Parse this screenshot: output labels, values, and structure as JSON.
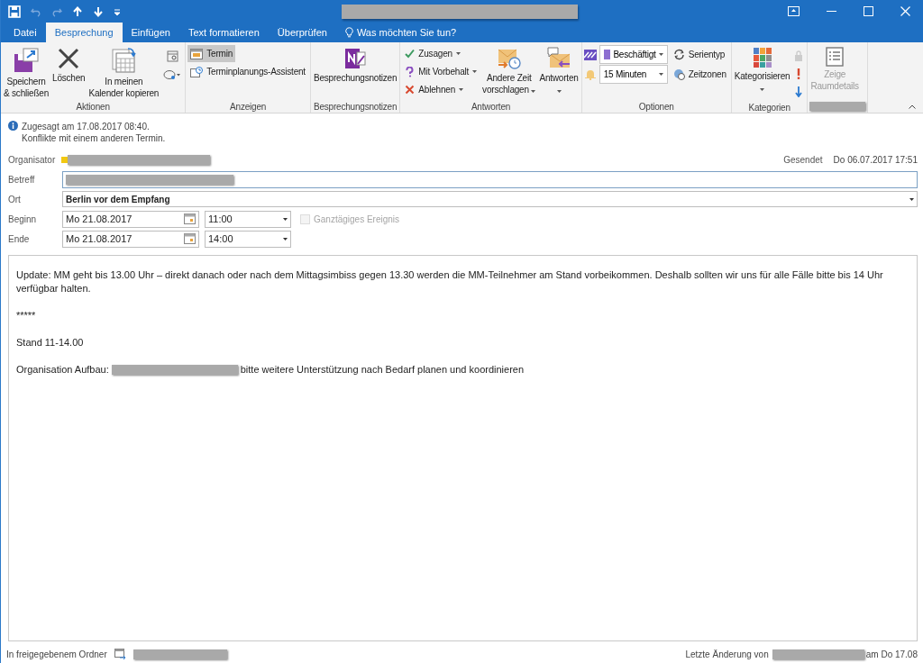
{
  "tabs": [
    {
      "label": "Datei",
      "selected": false
    },
    {
      "label": "Besprechung",
      "selected": true
    },
    {
      "label": "Einfügen",
      "selected": false
    },
    {
      "label": "Text formatieren",
      "selected": false
    },
    {
      "label": "Überprüfen",
      "selected": false
    }
  ],
  "tell_me": "Was möchten Sie tun?",
  "ribbon": {
    "aktionen": {
      "label": "Aktionen",
      "save": [
        "Speichern",
        "& schließen"
      ],
      "delete": "Löschen",
      "copy": [
        "In meinen",
        "Kalender kopieren"
      ]
    },
    "anzeigen": {
      "label": "Anzeigen",
      "items": [
        {
          "label": "Termin",
          "selected": true
        },
        {
          "label": "Terminplanungs-Assistent",
          "selected": false
        }
      ]
    },
    "notes": {
      "label": "Besprechungsnotizen",
      "button": "Besprechungsnotizen"
    },
    "antworten": {
      "label": "Antworten",
      "items": [
        "Zusagen",
        "Mit Vorbehalt",
        "Ablehnen"
      ],
      "propose": [
        "Andere Zeit",
        "vorschlagen"
      ],
      "reply": "Antworten"
    },
    "optionen": {
      "label": "Optionen",
      "show_as": "Beschäftigt",
      "reminder": "15 Minuten",
      "recurrence": "Serientyp",
      "timezones": "Zeitzonen"
    },
    "kategorien": {
      "label": "Kategorien",
      "button": "Kategorisieren"
    },
    "room": {
      "lines": [
        "Zeige",
        "Raumdetails"
      ],
      "disabled": true
    }
  },
  "info": [
    "Zugesagt am 17.08.2017 08:40.",
    "Konflikte mit einem anderen Termin."
  ],
  "organizer": {
    "label": "Organisator",
    "color": "#f2c811"
  },
  "sent": {
    "label": "Gesendet",
    "value": "Do 06.07.2017 17:51"
  },
  "subject": {
    "label": "Betreff"
  },
  "location": {
    "label": "Ort",
    "value": "Berlin vor dem Empfang"
  },
  "start": {
    "label": "Beginn",
    "date": "Mo 21.08.2017",
    "time": "11:00"
  },
  "end": {
    "label": "Ende",
    "date": "Mo 21.08.2017",
    "time": "14:00"
  },
  "all_day": {
    "label": "Ganztägiges Ereignis",
    "checked": false,
    "disabled": true
  },
  "body": [
    "Update: MM geht bis 13.00 Uhr – direkt danach oder nach dem Mittagsimbiss gegen 13.30 werden die MM-Teilnehmer am Stand vorbeikommen. Deshalb sollten wir uns für alle Fälle bitte bis 14 Uhr verfügbar halten.",
    "*****",
    "Stand 11-14.00"
  ],
  "body_last": {
    "before": "Organisation Aufbau:",
    "after": "bitte weitere Unterstützung nach Bedarf planen und koordinieren"
  },
  "status": {
    "folder": "In freigegebenem Ordner",
    "modified": "Letzte Änderung von",
    "modified_date": "am Do 17.08"
  }
}
